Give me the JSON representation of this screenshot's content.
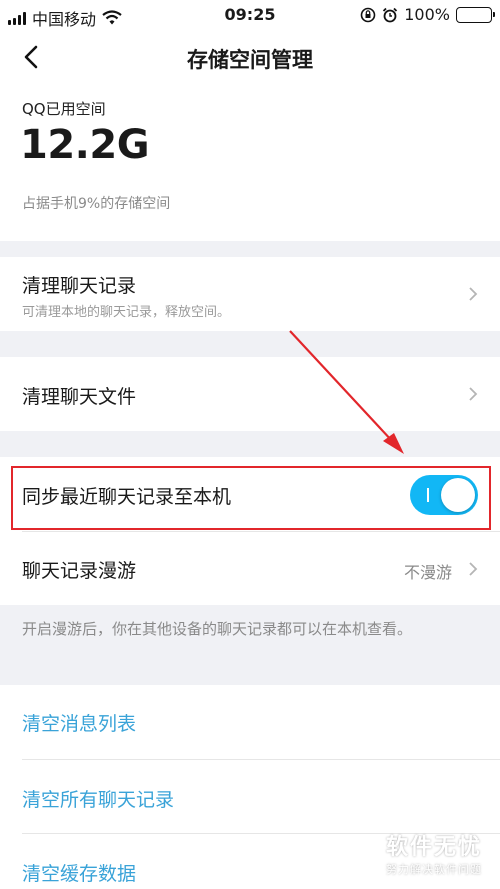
{
  "status_bar": {
    "carrier": "中国移动",
    "time": "09:25",
    "battery": "100%",
    "battery_level": 1.0
  },
  "nav": {
    "title": "存储空间管理"
  },
  "storage": {
    "label": "QQ已用空间",
    "value": "12.2G",
    "note": "占据手机9%的存储空间"
  },
  "items": {
    "clear_chat_records": {
      "title": "清理聊天记录",
      "subtitle": "可清理本地的聊天记录，释放空间。"
    },
    "clear_chat_files": {
      "title": "清理聊天文件"
    },
    "sync_recent": {
      "title": "同步最近聊天记录至本机",
      "enabled": true
    },
    "roaming": {
      "title": "聊天记录漫游",
      "value": "不漫游"
    }
  },
  "hint": "开启漫游后，你在其他设备的聊天记录都可以在本机查看。",
  "links": {
    "clear_message_list": "清空消息列表",
    "clear_all_records": "清空所有聊天记录",
    "clear_cache": "清空缓存数据"
  },
  "watermark": {
    "main": "软件无忧",
    "sub": "努力解决软件问题"
  },
  "colors": {
    "accent": "#12b7f5",
    "link": "#3aa3d8",
    "annotation": "#e2262b",
    "background": "#f0f1f5"
  }
}
